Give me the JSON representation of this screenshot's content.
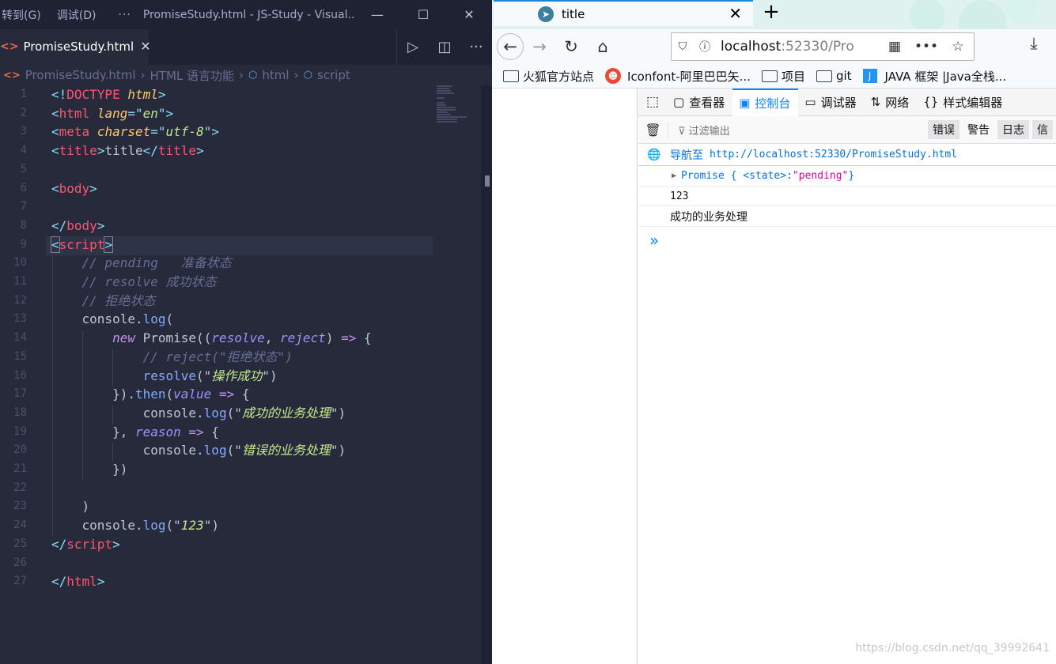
{
  "vscode": {
    "menu": [
      "转到(G)",
      "调试(D)"
    ],
    "more": "···",
    "window_title": "PromiseStudy.html - JS-Study - Visual...",
    "tab_label": "PromiseStudy.html",
    "breadcrumb": [
      "PromiseStudy.html",
      "HTML 语言功能",
      "html",
      "script"
    ],
    "line_numbers": [
      "1",
      "2",
      "3",
      "4",
      "5",
      "6",
      "7",
      "8",
      "9",
      "10",
      "11",
      "12",
      "13",
      "14",
      "15",
      "16",
      "17",
      "18",
      "19",
      "20",
      "21",
      "22",
      "23",
      "24",
      "25",
      "26",
      "27"
    ]
  },
  "firefox": {
    "tab_title": "title",
    "url_host": "localhost",
    "url_rest": ":52330/Pro",
    "bookmarks": [
      "火狐官方站点",
      "Iconfont-阿里巴巴矢...",
      "项目",
      "git",
      "JAVA 框架 |Java全栈..."
    ],
    "devtools": {
      "tabs": [
        "查看器",
        "控制台",
        "调试器",
        "网络",
        "样式编辑器"
      ],
      "filter_placeholder": "过滤输出",
      "filter_buttons": [
        "错误",
        "警告",
        "日志",
        "信"
      ],
      "nav_label": "导航至",
      "nav_url": "http://localhost:52330/PromiseStudy.html",
      "promise_prefix": "Promise { <state>: ",
      "promise_state": "\"pending\"",
      "promise_suffix": " }",
      "output_number": "123",
      "output_message": "成功的业务处理",
      "prompt": "»"
    }
  },
  "watermark": "https://blog.csdn.net/qq_39992641"
}
